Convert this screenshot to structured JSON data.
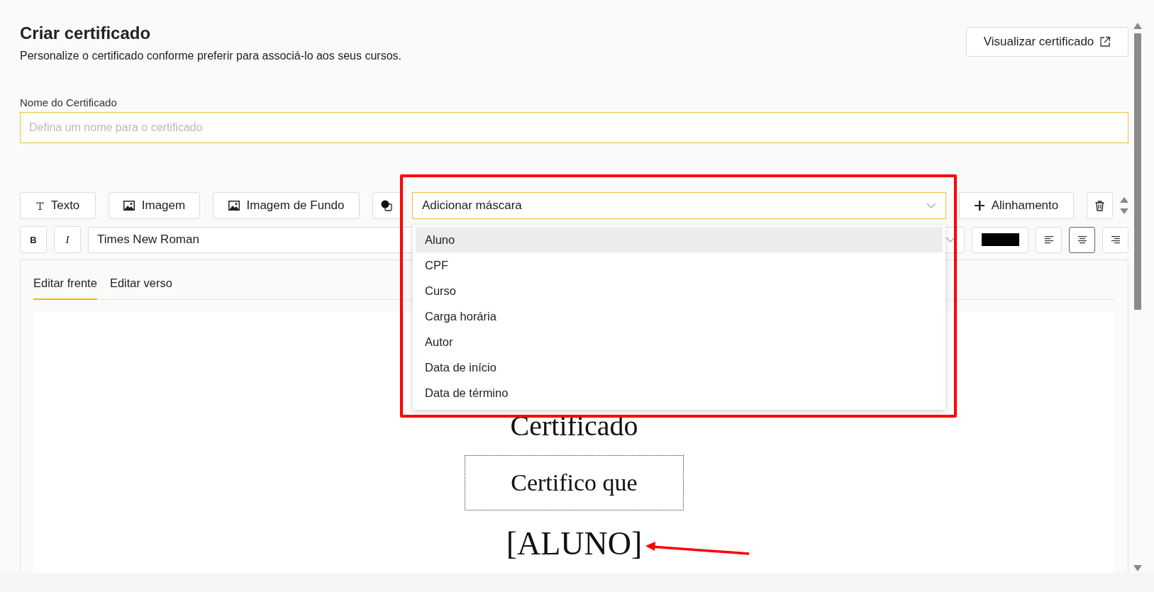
{
  "header": {
    "title": "Criar certificado",
    "subtitle": "Personalize o certificado conforme preferir para associá-lo aos seus cursos.",
    "preview_button": "Visualizar certificado"
  },
  "name_field": {
    "label": "Nome do Certificado",
    "placeholder": "Defina um nome para o certificado"
  },
  "toolbar": {
    "buttons": [
      {
        "kind": "text",
        "label": "Texto"
      },
      {
        "kind": "image",
        "label": "Imagem"
      },
      {
        "kind": "image",
        "label": "Imagem de Fundo"
      },
      {
        "kind": "shape"
      }
    ],
    "mask_select": {
      "value": "Adicionar máscara",
      "expanded": true,
      "options": [
        {
          "label": "Aluno",
          "selected": true
        },
        {
          "label": "CPF",
          "selected": false
        },
        {
          "label": "Curso",
          "selected": false
        },
        {
          "label": "Carga horária",
          "selected": false
        },
        {
          "label": "Autor",
          "selected": false
        },
        {
          "label": "Data de início",
          "selected": false
        },
        {
          "label": "Data de término",
          "selected": false
        }
      ]
    },
    "align_button": "Alinhamento"
  },
  "format_bar": {
    "bold": "B",
    "italic": "I",
    "font": "Times New Roman",
    "color": "#000000",
    "alignments": [
      {
        "kind": "left",
        "selected": false
      },
      {
        "kind": "center",
        "selected": true
      },
      {
        "kind": "right",
        "selected": false
      }
    ]
  },
  "tabs": [
    {
      "label": "Editar frente",
      "selected": true
    },
    {
      "label": "Editar verso",
      "selected": false
    }
  ],
  "canvas": {
    "elements": [
      {
        "kind": "heading",
        "text": "Certificado"
      },
      {
        "kind": "framed",
        "text": "Certifico que"
      },
      {
        "kind": "mask",
        "text": "[ALUNO]"
      }
    ]
  }
}
